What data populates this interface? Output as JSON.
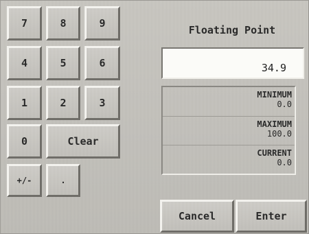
{
  "keypad": {
    "k7": "7",
    "k8": "8",
    "k9": "9",
    "k4": "4",
    "k5": "5",
    "k6": "6",
    "k1": "1",
    "k2": "2",
    "k3": "3",
    "k0": "0",
    "clear": "Clear",
    "sign": "+/-",
    "dot": "."
  },
  "display": {
    "title": "Floating Point",
    "value": "34.9"
  },
  "limits": {
    "minimum_label": "MINIMUM",
    "minimum_value": "0.0",
    "maximum_label": "MAXIMUM",
    "maximum_value": "100.0",
    "current_label": "CURRENT",
    "current_value": "0.0"
  },
  "actions": {
    "cancel": "Cancel",
    "enter": "Enter"
  }
}
